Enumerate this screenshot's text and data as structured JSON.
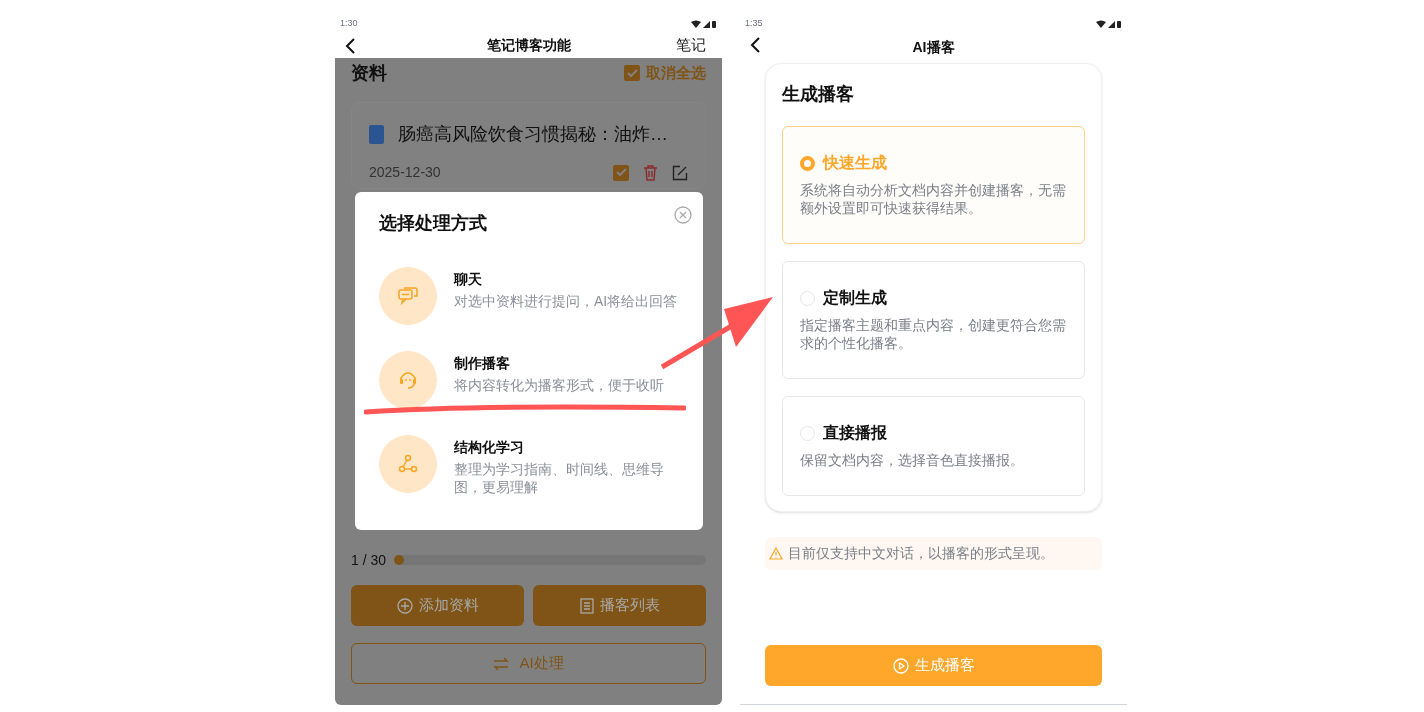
{
  "left_screen": {
    "status_time": "1:30",
    "header": {
      "title": "笔记博客功能",
      "action": "笔记"
    },
    "materials": {
      "heading": "资料",
      "select_all": {
        "label": "取消全选",
        "checked": true
      }
    },
    "documents": [
      {
        "title": "肠癌高风险饮食习惯揭秘：油炸…",
        "date": "2025-12-30",
        "checked": true
      }
    ],
    "progress": {
      "reading": "1 / 30",
      "level": 0.03
    },
    "buttons": [
      {
        "label": "添加资料",
        "kind": "filled"
      },
      {
        "label": "播客列表",
        "kind": "filled"
      },
      {
        "label": "AI处理",
        "kind": "outline"
      }
    ],
    "dialog": {
      "title": "选择处理方式",
      "options": [
        {
          "title": "聊天",
          "description": "对选中资料进行提问，AI将给出回答"
        },
        {
          "title": "制作播客",
          "description": "将内容转化为播客形式，便于收听"
        },
        {
          "title": "结构化学习",
          "description": "整理为学习指南、时间线、思维导图，更易理解"
        }
      ]
    }
  },
  "right_screen": {
    "status_time": "1:35",
    "header": {
      "title": "AI播客"
    },
    "card": {
      "title": "生成播客",
      "options": [
        {
          "title": "快速生成",
          "description": "系统将自动分析文档内容并创建播客，无需额外设置即可快速获得结果。",
          "selected": true
        },
        {
          "title": "定制生成",
          "description": "指定播客主题和重点内容，创建更符合您需求的个性化播客。",
          "selected": false
        },
        {
          "title": "直接播报",
          "description": "保留文档内容，选择音色直接播报。",
          "selected": false
        }
      ]
    },
    "notice": "目前仅支持中文对话，以播客的形式呈现。",
    "generate_button": "生成播客"
  }
}
